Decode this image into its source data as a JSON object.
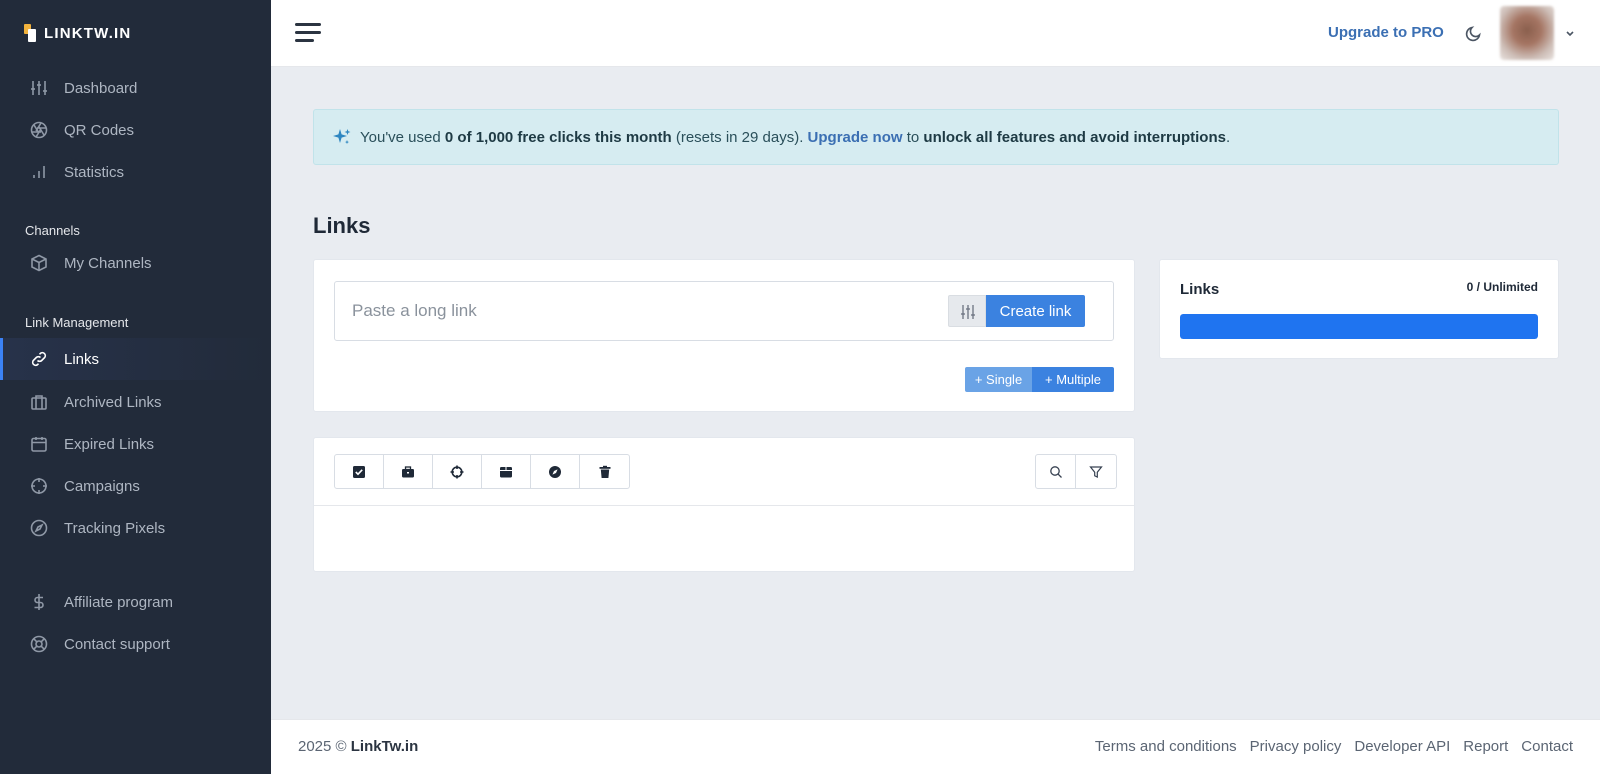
{
  "brand": {
    "name": "LINKTW.IN"
  },
  "sidebar": {
    "main_items": [
      {
        "label": "Dashboard",
        "icon": "sliders-icon"
      },
      {
        "label": "QR Codes",
        "icon": "aperture-icon"
      },
      {
        "label": "Statistics",
        "icon": "bar-chart-icon"
      }
    ],
    "channels_label": "Channels",
    "channels_items": [
      {
        "label": "My Channels",
        "icon": "box-icon"
      }
    ],
    "link_mgmt_label": "Link Management",
    "link_items": [
      {
        "label": "Links",
        "icon": "link-icon",
        "active": true
      },
      {
        "label": "Archived Links",
        "icon": "briefcase-icon"
      },
      {
        "label": "Expired Links",
        "icon": "calendar-icon"
      },
      {
        "label": "Campaigns",
        "icon": "crosshair-icon"
      },
      {
        "label": "Tracking Pixels",
        "icon": "compass-icon"
      }
    ],
    "extra_items": [
      {
        "label": "Affiliate program",
        "icon": "dollar-icon"
      },
      {
        "label": "Contact support",
        "icon": "life-buoy-icon"
      }
    ]
  },
  "topbar": {
    "upgrade_label": "Upgrade to PRO"
  },
  "alert": {
    "prefix": "You've used ",
    "usage": "0 of 1,000 free clicks this month",
    "resets": " (resets in 29 days). ",
    "upgrade_link": "Upgrade now",
    "middle": " to ",
    "benefit": "unlock all features and avoid interruptions",
    "suffix": "."
  },
  "page": {
    "title": "Links"
  },
  "create": {
    "placeholder": "Paste a long link",
    "create_button": "Create link",
    "mode_single": "+ Single",
    "mode_multiple": "+ Multiple"
  },
  "stats": {
    "title": "Links",
    "count": "0 / Unlimited",
    "progress_fraction": 1.0
  },
  "toolbar": {
    "tools": [
      "select-all-icon",
      "briefcase-icon",
      "crosshair-icon",
      "archive-icon",
      "compass-icon",
      "trash-icon"
    ],
    "right_tools": [
      "search-icon",
      "filter-icon"
    ]
  },
  "footer": {
    "year": "2025 © ",
    "brand": "LinkTw.in",
    "links": [
      "Terms and conditions",
      "Privacy policy",
      "Developer API",
      "Report",
      "Contact"
    ]
  },
  "colors": {
    "sidebar_bg": "#222b3a",
    "accent": "#3b82e0",
    "progress": "#1f74f0",
    "alert_bg": "#d6ecf1"
  }
}
